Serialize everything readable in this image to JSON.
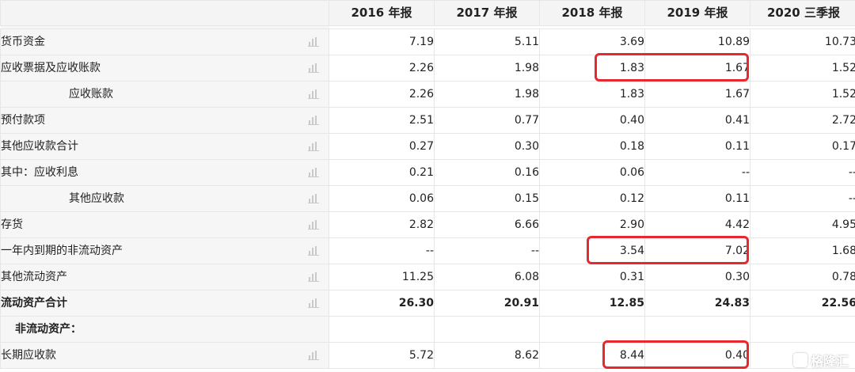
{
  "header": {
    "columns": [
      "2016 年报",
      "2017 年报",
      "2018 年报",
      "2019 年报",
      "2020 三季报"
    ]
  },
  "rows": [
    {
      "label": "货币资金",
      "values": [
        "7.19",
        "5.11",
        "3.69",
        "10.89",
        "10.73"
      ],
      "indent": 1,
      "bold": false
    },
    {
      "label": "应收票据及应收账款",
      "values": [
        "2.26",
        "1.98",
        "1.83",
        "1.67",
        "1.52"
      ],
      "indent": 1,
      "bold": false
    },
    {
      "label": "应收账款",
      "values": [
        "2.26",
        "1.98",
        "1.83",
        "1.67",
        "1.52"
      ],
      "indent": 2,
      "bold": false
    },
    {
      "label": "预付款项",
      "values": [
        "2.51",
        "0.77",
        "0.40",
        "0.41",
        "2.72"
      ],
      "indent": 1,
      "bold": false
    },
    {
      "label": "其他应收款合计",
      "values": [
        "0.27",
        "0.30",
        "0.18",
        "0.11",
        "0.17"
      ],
      "indent": 1,
      "bold": false
    },
    {
      "label": "其中：应收利息",
      "values": [
        "0.21",
        "0.16",
        "0.06",
        "--",
        "--"
      ],
      "indent": 1,
      "bold": false
    },
    {
      "label": "其他应收款",
      "values": [
        "0.06",
        "0.15",
        "0.12",
        "0.11",
        "--"
      ],
      "indent": 2,
      "bold": false
    },
    {
      "label": "存货",
      "values": [
        "2.82",
        "6.66",
        "2.90",
        "4.42",
        "4.95"
      ],
      "indent": 1,
      "bold": false
    },
    {
      "label": "一年内到期的非流动资产",
      "values": [
        "--",
        "--",
        "3.54",
        "7.02",
        "1.68"
      ],
      "indent": 1,
      "bold": false
    },
    {
      "label": "其他流动资产",
      "values": [
        "11.25",
        "6.08",
        "0.31",
        "0.30",
        "0.78"
      ],
      "indent": 1,
      "bold": false
    },
    {
      "label": "流动资产合计",
      "values": [
        "26.30",
        "20.91",
        "12.85",
        "24.83",
        "22.56"
      ],
      "indent": 1,
      "bold": true
    },
    {
      "label": "非流动资产：",
      "values": [
        "",
        "",
        "",
        "",
        ""
      ],
      "indent": 0,
      "bold": true,
      "section": true
    },
    {
      "label": "长期应收款",
      "values": [
        "5.72",
        "8.62",
        "8.44",
        "0.40",
        ""
      ],
      "indent": 1,
      "bold": false
    }
  ],
  "icons": {
    "row_chart": "bar-chart-icon",
    "watermark_logo": "gelonghui-logo-icon"
  },
  "colors": {
    "highlight": "#e8272f",
    "label_bg": "#f6f6f6",
    "header_bg": "#f4f4f4",
    "grid": "#e6e6e6"
  },
  "watermark": {
    "text": "格隆汇"
  }
}
